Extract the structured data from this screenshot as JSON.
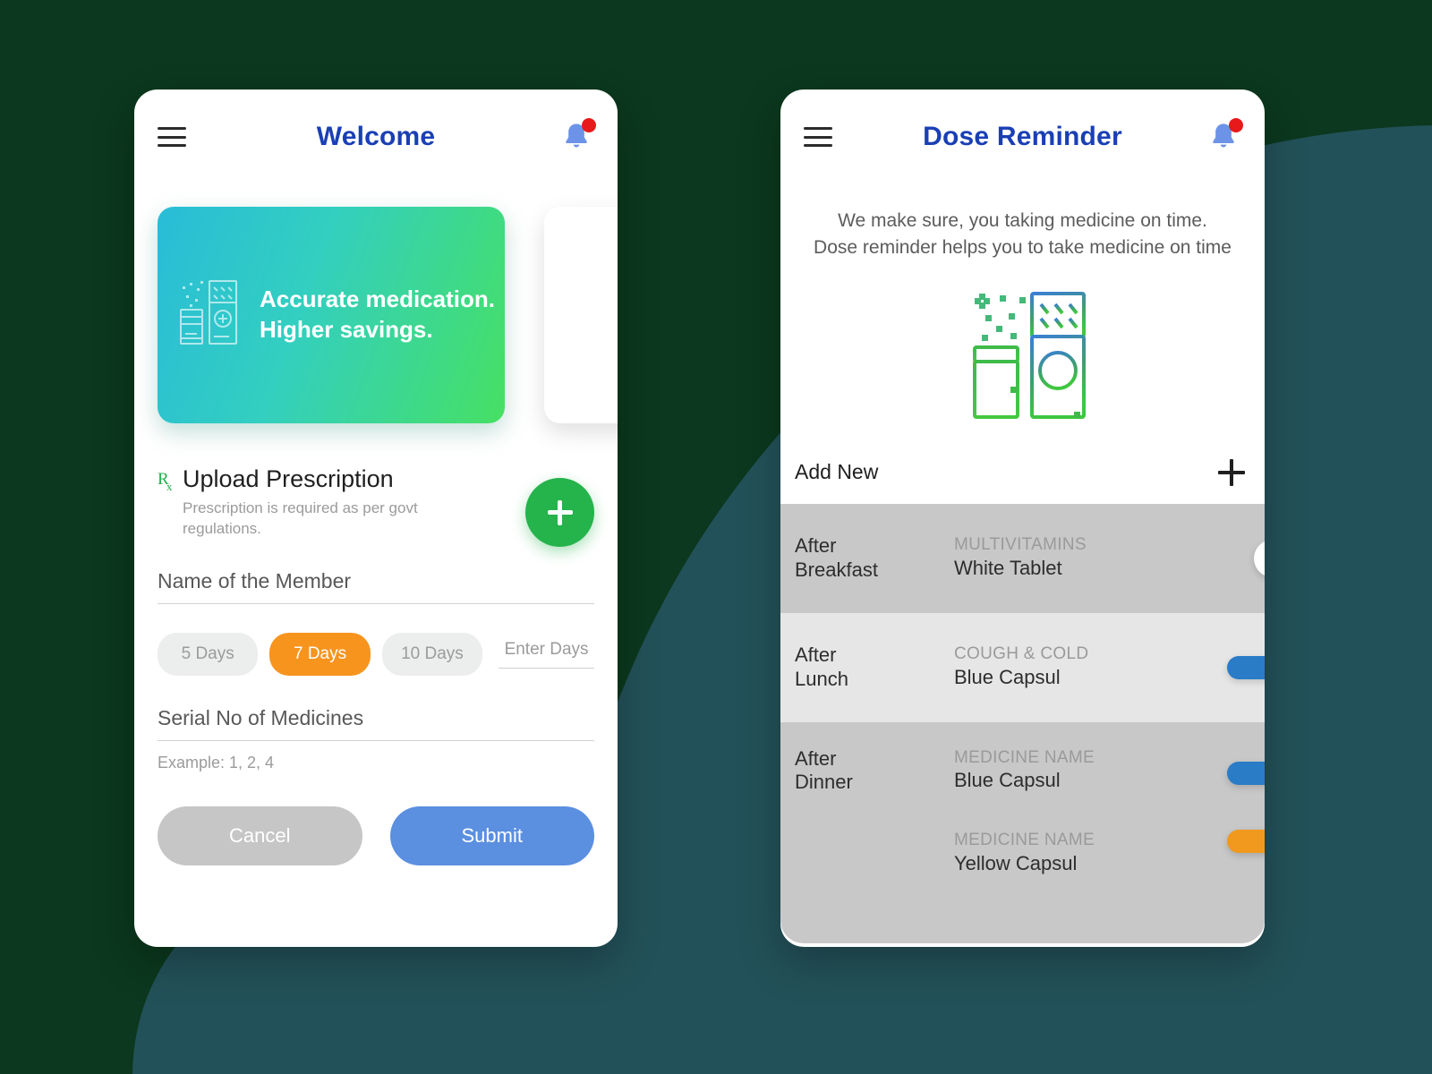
{
  "background": {
    "dark_green": "#0b381e",
    "teal": "#235159"
  },
  "left_phone": {
    "appbar": {
      "menu_icon": "hamburger-menu-icon",
      "title": "Welcome",
      "bell_icon": "notification-bell-icon",
      "badge": ""
    },
    "promo": {
      "icon": "medicine-bottle-box-icon",
      "line1": "Accurate medication.",
      "line2": "Higher savings."
    },
    "upload": {
      "rx_icon": "rx-prescription-icon",
      "title": "Upload Prescription",
      "subtitle": "Prescription is required as per govt regulations.",
      "fab_icon": "plus-icon"
    },
    "member_field": {
      "label": "Name of the Member",
      "value": ""
    },
    "days": {
      "options": [
        "5 Days",
        "7 Days",
        "10 Days"
      ],
      "selected": "7 Days",
      "custom_placeholder": "Enter Days",
      "active_color": "#f7941e"
    },
    "serial_field": {
      "label": "Serial No of Medicines",
      "value": "",
      "helper": "Example: 1, 2, 4"
    },
    "actions": {
      "cancel": "Cancel",
      "submit": "Submit",
      "cancel_color": "#c6c6c6",
      "submit_color": "#5b8fe0"
    }
  },
  "right_phone": {
    "appbar": {
      "menu_icon": "hamburger-menu-icon",
      "title": "Dose Reminder",
      "bell_icon": "notification-bell-icon"
    },
    "description_line1": "We make sure, you taking medicine on time.",
    "description_line2": "Dose reminder helps you to take medicine on time",
    "illustration_icon": "medicine-bottle-box-icon",
    "add_new": {
      "label": "Add New",
      "icon": "plus-icon"
    },
    "reminders": [
      {
        "when_line1": "After",
        "when_line2": "Breakfast",
        "row_bg": "#c8c8c8",
        "medicines": [
          {
            "name": "MULTIVITAMINS",
            "desc": "White Tablet",
            "pill_shape": "tablet",
            "pill_color": "#ffffff"
          }
        ]
      },
      {
        "when_line1": "After",
        "when_line2": "Lunch",
        "row_bg": "#e6e6e6",
        "medicines": [
          {
            "name": "COUGH & COLD",
            "desc": "Blue Capsul",
            "pill_shape": "capsule",
            "pill_color": "#2a7cc7"
          }
        ]
      },
      {
        "when_line1": "After",
        "when_line2": "Dinner",
        "row_bg": "#c8c8c8",
        "medicines": [
          {
            "name": "MEDICINE NAME",
            "desc": "Blue Capsul",
            "pill_shape": "capsule",
            "pill_color": "#2a7cc7"
          },
          {
            "name": "MEDICINE NAME",
            "desc": "Yellow Capsul",
            "pill_shape": "capsule",
            "pill_color": "#f0991e"
          }
        ]
      }
    ]
  }
}
